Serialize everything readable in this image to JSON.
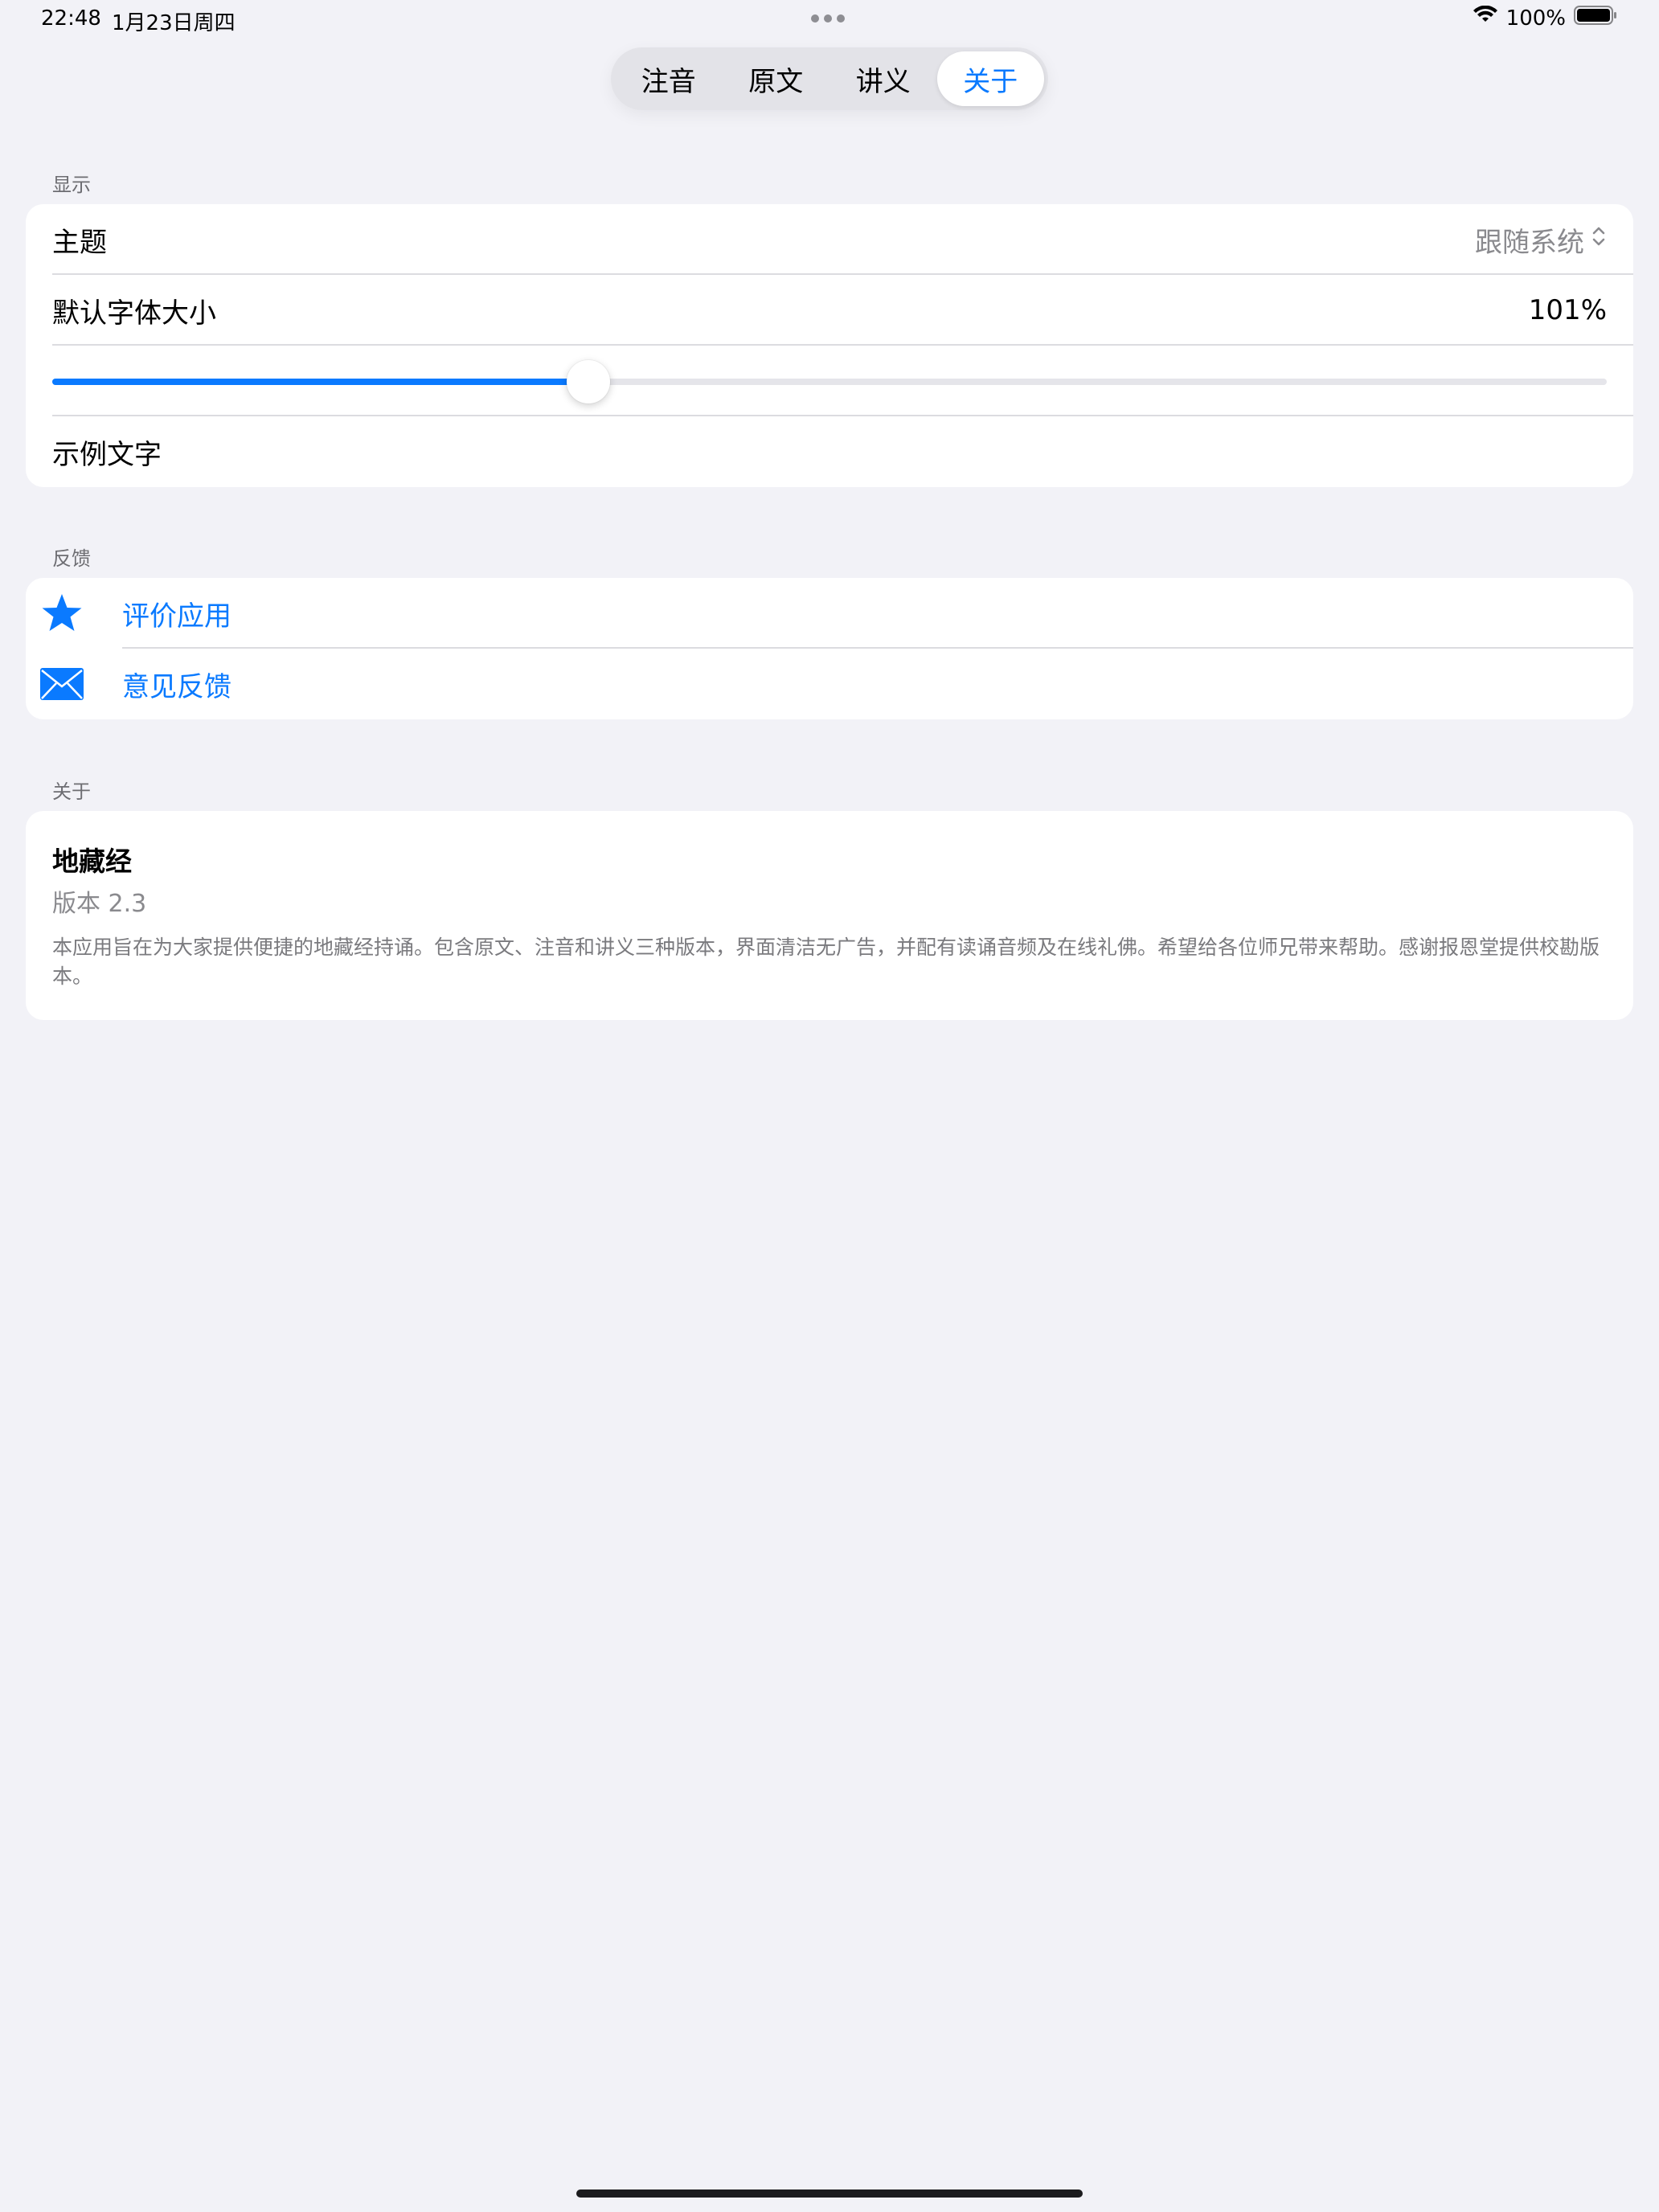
{
  "status_bar": {
    "time": "22:48",
    "date": "1月23日周四",
    "battery_percent": "100%",
    "battery_level": 1.0
  },
  "tabs": [
    {
      "label": "注音",
      "active": false
    },
    {
      "label": "原文",
      "active": false
    },
    {
      "label": "讲义",
      "active": false
    },
    {
      "label": "关于",
      "active": true
    }
  ],
  "display": {
    "header": "显示",
    "theme_label": "主题",
    "theme_value": "跟随系统",
    "font_size_label": "默认字体大小",
    "font_size_value": "101%",
    "font_slider_fraction": 0.345,
    "sample_text": "示例文字"
  },
  "feedback": {
    "header": "反馈",
    "rate_label": "评价应用",
    "feedback_label": "意见反馈"
  },
  "about": {
    "header": "关于",
    "app_name": "地藏经",
    "version": "版本 2.3",
    "description": "本应用旨在为大家提供便捷的地藏经持诵。包含原文、注音和讲义三种版本，界面清洁无广告，并配有读诵音频及在线礼佛。希望给各位师兄带来帮助。感谢报恩堂提供校勘版本。"
  },
  "colors": {
    "accent": "#0a7aff",
    "background": "#f2f2f7",
    "secondary_text": "#8a8a8e"
  }
}
